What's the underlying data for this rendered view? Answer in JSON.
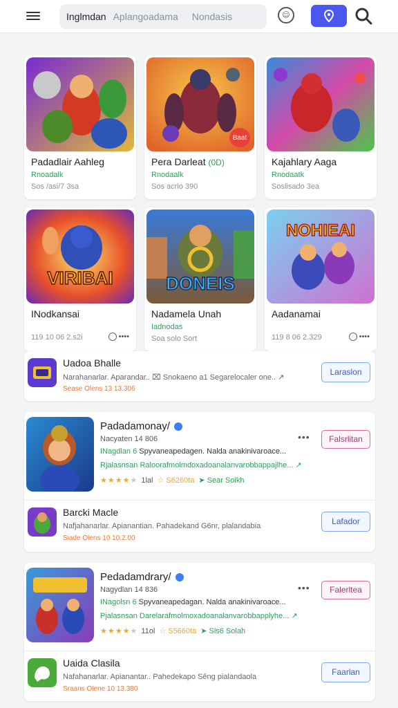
{
  "topbar": {
    "search_pill": [
      "Inglmdan",
      "Aplangoadama",
      "Nondasis"
    ]
  },
  "grid": [
    {
      "title": "Padadlair Aahleg",
      "sub": "Rnoadalk",
      "meta": "Sos /asi/7 3sa",
      "art": "heroes-red"
    },
    {
      "title": "Pera Darleat",
      "sub": "Rnodaalk",
      "meta": "Sos acrlo 390",
      "art": "hero-armor",
      "badge": "Baat",
      "extra": "(0D)"
    },
    {
      "title": "Kajahlary Aaga",
      "sub": "Rnodaatk",
      "meta": "Soslisado 3ea",
      "art": "heroes-rainbow"
    },
    {
      "title": "INodkansai",
      "sub": "",
      "meta": "119 10 06 2.s2i",
      "art": "villain-burst",
      "art_text": "VIRIBAI",
      "more": "••••"
    },
    {
      "title": "Nadamela Unah",
      "sub": "Iadnodas",
      "meta": "Soa solo Sort",
      "art": "warrior-gold",
      "art_text": "DONEIS"
    },
    {
      "title": "Aadanamai",
      "sub": "",
      "meta": "119 8 06 2.329",
      "art": "team-flying",
      "art_text": "NOHIEAI",
      "more": "••••"
    }
  ],
  "list_top": {
    "title": "Uadoa Bhalle",
    "desc": "Narahanarlar. Aparandar.. ⌧ Snokaeno a1 Segarelocaler one.. ↗",
    "meta": "Sease Olens 13 13.306",
    "button": "Laraslon"
  },
  "featured": [
    {
      "title": "Padadamonay/",
      "line2": "Nacyaten 14 806",
      "line3_green": "INagdlan 6",
      "line3": "Spyvaneapedagen. Nalda anakinivaroace...",
      "line4": "Rjalasnsan Raloorafmolmdoxadoanalanvarobbappajlhe...  ↗",
      "stars": "★★★★",
      "star_empty": "★",
      "count": "1lal",
      "size": "☆ S6260ta",
      "dl": "➤ Sear Soikh",
      "dots": "•••",
      "button": "Falsrlitan",
      "sub_row": {
        "title": "Barcki Macle",
        "desc": "Nafjahanarlar. Apianantian. Pahadekand G6nr, plalandabia",
        "meta": "Siade Olens 10 10.2.00",
        "button": "Lafador"
      }
    },
    {
      "title": "Pedadamdrary/",
      "line2": "Nagydlan 14 836",
      "line3_green": "INagolsn 6",
      "line3": "Spyvaneapedagan. Nalda anakinivaroace...",
      "line4": "Pjalasnsan Darelarafmolmoxadoanalanvarobbapplyhe...  ↗",
      "stars": "★★★★",
      "star_empty": "★",
      "count": "11ol",
      "size": "☆ S5660ta",
      "dl": "➤ Sls6 Solah",
      "dots": "•••",
      "button": "Falerltea",
      "sub_row": {
        "title": "Uaida Clasila",
        "desc": "Nafahanarlar. Apianantar.. Pahedekapo Sêng pialandaola",
        "meta": "Sraans Olene 10 13.380",
        "button": "Faarlan"
      }
    }
  ],
  "colors": {
    "accent": "#4a57f0",
    "green": "#2aa15a",
    "orange": "#e47a3c",
    "star": "#f5a623"
  }
}
